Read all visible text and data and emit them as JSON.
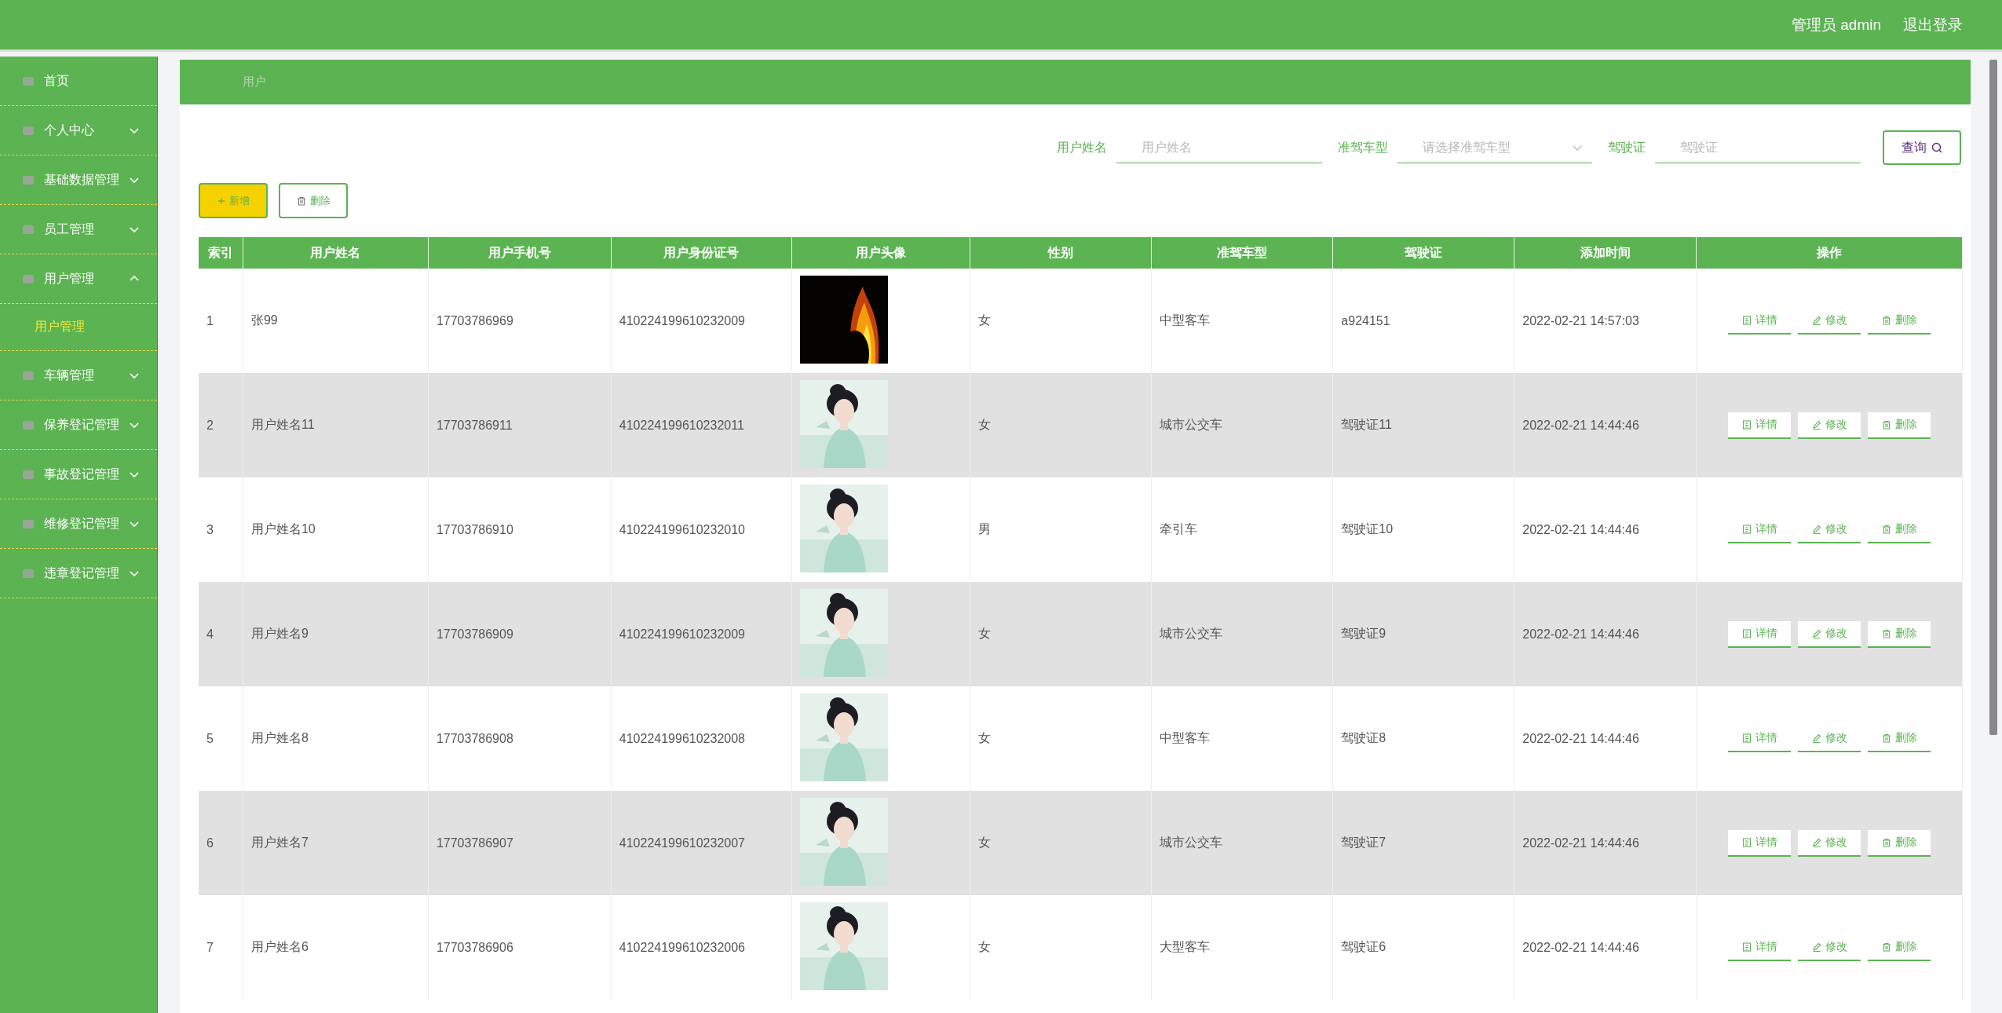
{
  "header": {
    "user": "管理员 admin",
    "logout": "退出登录"
  },
  "sidebar": {
    "items": [
      {
        "label": "首页"
      },
      {
        "label": "个人中心",
        "expanded": false
      },
      {
        "label": "基础数据管理",
        "expanded": false
      },
      {
        "label": "员工管理",
        "expanded": false
      },
      {
        "label": "用户管理",
        "expanded": true,
        "children": [
          {
            "label": "用户管理",
            "selected": true
          }
        ]
      },
      {
        "label": "车辆管理",
        "expanded": false
      },
      {
        "label": "保养登记管理",
        "expanded": false
      },
      {
        "label": "事故登记管理",
        "expanded": false
      },
      {
        "label": "维修登记管理",
        "expanded": false
      },
      {
        "label": "违章登记管理",
        "expanded": false
      }
    ]
  },
  "breadcrumb": "用户",
  "search": {
    "fields": [
      {
        "kind": "text",
        "label": "用户姓名",
        "placeholder": "用户姓名"
      },
      {
        "kind": "select",
        "label": "准驾车型",
        "placeholder": "请选择准驾车型"
      },
      {
        "kind": "text",
        "label": "驾驶证",
        "placeholder": "驾驶证"
      }
    ],
    "button": "查询"
  },
  "toolbar": {
    "add": "新增",
    "delete": "删除"
  },
  "table": {
    "columns": [
      "索引",
      "用户姓名",
      "用户手机号",
      "用户身份证号",
      "用户头像",
      "性别",
      "准驾车型",
      "驾驶证",
      "添加时间",
      "操作"
    ],
    "rows": [
      {
        "index": "1",
        "name": "张99",
        "phone": "17703786969",
        "id_number": "410224199610232009",
        "gender": "女",
        "vehicle_type": "中型客车",
        "license": "a924151",
        "added": "2022-02-21 14:57:03",
        "actions": [
          "详情",
          "修改",
          "删除"
        ]
      },
      {
        "index": "2",
        "name": "用户姓名11",
        "phone": "17703786911",
        "id_number": "410224199610232011",
        "gender": "女",
        "vehicle_type": "城市公交车",
        "license": "驾驶证11",
        "added": "2022-02-21 14:44:46",
        "actions": [
          "详情",
          "修改",
          "删除"
        ]
      },
      {
        "index": "3",
        "name": "用户姓名10",
        "phone": "17703786910",
        "id_number": "410224199610232010",
        "gender": "男",
        "vehicle_type": "牵引车",
        "license": "驾驶证10",
        "added": "2022-02-21 14:44:46",
        "actions": [
          "详情",
          "修改",
          "删除"
        ]
      },
      {
        "index": "4",
        "name": "用户姓名9",
        "phone": "17703786909",
        "id_number": "410224199610232009",
        "gender": "女",
        "vehicle_type": "城市公交车",
        "license": "驾驶证9",
        "added": "2022-02-21 14:44:46",
        "actions": [
          "详情",
          "修改",
          "删除"
        ]
      },
      {
        "index": "5",
        "name": "用户姓名8",
        "phone": "17703786908",
        "id_number": "410224199610232008",
        "gender": "女",
        "vehicle_type": "中型客车",
        "license": "驾驶证8",
        "added": "2022-02-21 14:44:46",
        "actions": [
          "详情",
          "修改",
          "删除"
        ]
      },
      {
        "index": "6",
        "name": "用户姓名7",
        "phone": "17703786907",
        "id_number": "410224199610232007",
        "gender": "女",
        "vehicle_type": "城市公交车",
        "license": "驾驶证7",
        "added": "2022-02-21 14:44:46",
        "actions": [
          "详情",
          "修改",
          "删除"
        ]
      },
      {
        "index": "7",
        "name": "用户姓名6",
        "phone": "17703786906",
        "id_number": "410224199610232006",
        "gender": "女",
        "vehicle_type": "大型客车",
        "license": "驾驶证6",
        "added": "2022-02-21 14:44:46",
        "actions": [
          "详情",
          "修改",
          "删除"
        ]
      }
    ]
  }
}
